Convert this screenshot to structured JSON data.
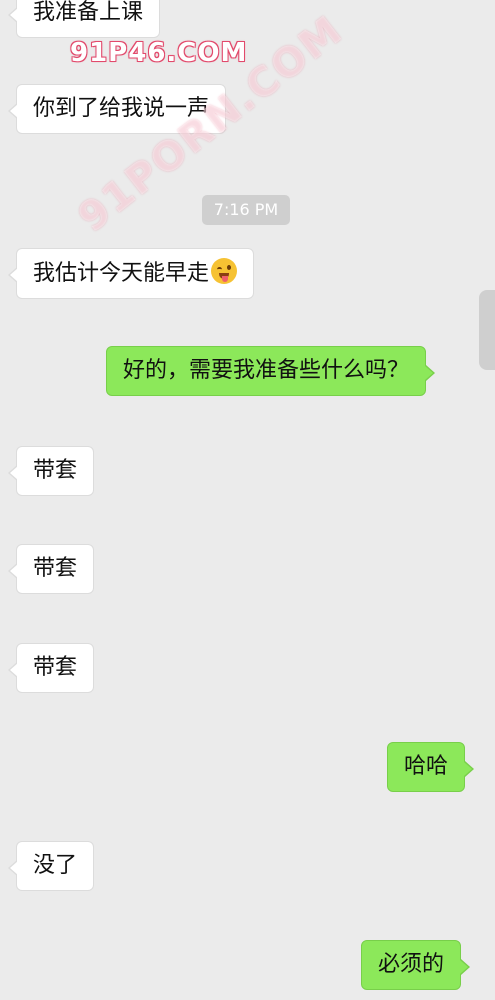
{
  "watermark_top": "91P46.COM",
  "watermark_diag": "91PORN.COM",
  "timestamp": "7:16 PM",
  "messages": [
    {
      "side": "in",
      "text": "我准备上课"
    },
    {
      "side": "in",
      "text": "你到了给我说一声"
    },
    {
      "side": "in",
      "text": "我估计今天能早走",
      "emoji": "winking-tongue-face"
    },
    {
      "side": "out",
      "text": "好的，需要我准备些什么吗？"
    },
    {
      "side": "in",
      "text": "带套"
    },
    {
      "side": "in",
      "text": "带套"
    },
    {
      "side": "in",
      "text": "带套"
    },
    {
      "side": "out",
      "text": "哈哈"
    },
    {
      "side": "in",
      "text": "没了"
    },
    {
      "side": "out",
      "text": "必须的"
    }
  ],
  "colors": {
    "background": "#ebebeb",
    "incoming_bubble": "#ffffff",
    "outgoing_bubble": "#8ce85a",
    "timestamp_bg": "#cfcfcf"
  }
}
